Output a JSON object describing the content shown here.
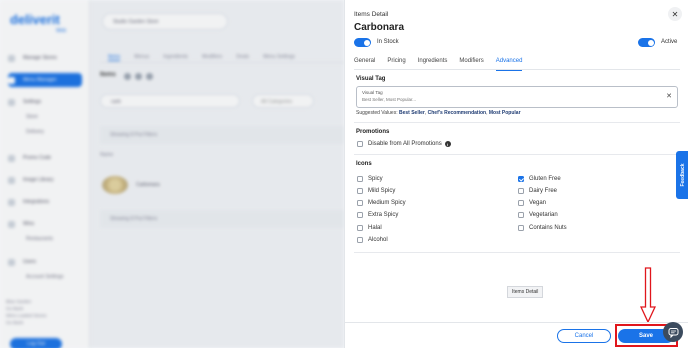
{
  "background_app": {
    "logo": "deliverit",
    "logo_sub": "Web",
    "sidebar_items": [
      "Manage Stores",
      "Menu Manager",
      "Settings",
      "Promo Code",
      "Image Library",
      "Integrations",
      "Wins",
      "Users"
    ],
    "sidebar_subitems": [
      "Store",
      "Delivery",
      "Restaurants",
      "Account Settings"
    ],
    "sidebar_footer": [
      "Blue Garden",
      "Go Back",
      "Wins Loaded Stores",
      "Go Back"
    ],
    "sidebar_button": "Log Out",
    "store_select": "Studio Garden Store",
    "tabs": [
      "Items",
      "Menus",
      "Ingredients",
      "Modifiers",
      "Deals",
      "Menu Settings"
    ],
    "items_heading": "Items",
    "search_value": "carb",
    "category_placeholder": "All Categories",
    "rows": [
      "Showing 8 Put Filters",
      "Showing 8 Put Filters"
    ],
    "name_header": "Name",
    "food_item": "Carbonara"
  },
  "panel": {
    "title": "Items Detail",
    "item_name": "Carbonara",
    "in_stock_label": "In Stock",
    "active_label": "Active",
    "tabs": [
      {
        "label": "General",
        "active": false
      },
      {
        "label": "Pricing",
        "active": false
      },
      {
        "label": "Ingredients",
        "active": false
      },
      {
        "label": "Modifiers",
        "active": false
      },
      {
        "label": "Advanced",
        "active": true
      }
    ],
    "visual_tag": {
      "section_title": "Visual Tag",
      "field_label": "Visual Tag",
      "placeholder": "Best Seller, Most Popular...",
      "clear_icon": "x",
      "suggested_prefix": "Suggested Values:",
      "suggested_values": [
        "Best Seller",
        "Chef's Recommendation",
        "Most Popular"
      ]
    },
    "promotions": {
      "section_title": "Promotions",
      "disable_label": "Disable from All Promotions",
      "checked": false
    },
    "icons": {
      "section_title": "Icons",
      "left": [
        {
          "label": "Spicy",
          "checked": false
        },
        {
          "label": "Mild Spicy",
          "checked": false
        },
        {
          "label": "Medium Spicy",
          "checked": false
        },
        {
          "label": "Extra Spicy",
          "checked": false
        },
        {
          "label": "Halal",
          "checked": false
        },
        {
          "label": "Alcohol",
          "checked": false
        }
      ],
      "right": [
        {
          "label": "Gluten Free",
          "checked": true
        },
        {
          "label": "Dairy Free",
          "checked": false
        },
        {
          "label": "Vegan",
          "checked": false
        },
        {
          "label": "Vegetarian",
          "checked": false
        },
        {
          "label": "Contains Nuts",
          "checked": false
        }
      ]
    },
    "tooltip": "Items Detail",
    "cancel_label": "Cancel",
    "save_label": "Save",
    "feedback_label": "Feedback"
  },
  "colors": {
    "accent": "#1a73e8",
    "highlight": "#e0161c"
  }
}
